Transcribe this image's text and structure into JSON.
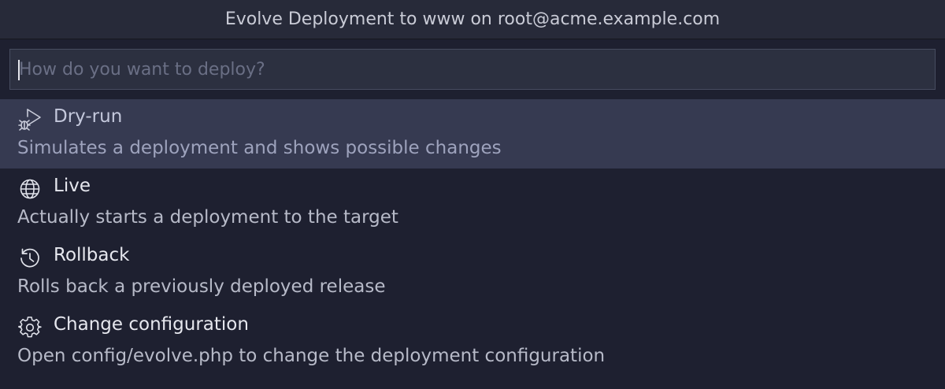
{
  "window": {
    "title": "Evolve Deployment to www on root@acme.example.com"
  },
  "search": {
    "value": "",
    "placeholder": "How do you want to deploy?"
  },
  "options": [
    {
      "label": "Dry-run",
      "description": "Simulates a deployment and shows possible changes",
      "icon": "debug-run-icon",
      "selected": true
    },
    {
      "label": "Live",
      "description": "Actually starts a deployment to the target",
      "icon": "globe-icon",
      "selected": false
    },
    {
      "label": "Rollback",
      "description": "Rolls back a previously deployed release",
      "icon": "history-icon",
      "selected": false
    },
    {
      "label": "Change configuration",
      "description": "Open config/evolve.php to change the deployment configuration",
      "icon": "gear-icon",
      "selected": false
    }
  ],
  "colors": {
    "background": "#1e2030",
    "selected_row": "#363a51",
    "input_background": "#2c3040"
  }
}
